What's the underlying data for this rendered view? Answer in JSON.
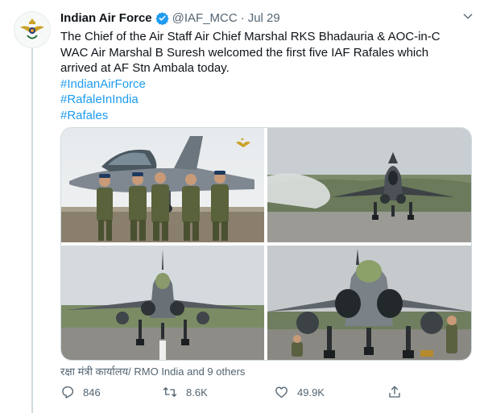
{
  "tweet": {
    "author_name": "Indian Air Force",
    "handle": "@IAF_MCC",
    "separator": "·",
    "date": "Jul 29",
    "text_lines": [
      "The Chief of the Air Staff Air Chief Marshal RKS Bhadauria & AOC-in-C",
      "WAC Air Marshal B Suresh welcomed the first five IAF Rafales which",
      "arrived at AF Stn Ambala today."
    ],
    "hashtags": [
      "#IndianAirForce",
      "#RafaleInIndia",
      "#Rafales"
    ],
    "tagged_text": "रक्षा मंत्री कार्यालय/ RMO India and 9 others"
  },
  "actions": {
    "reply_count": "846",
    "retweet_count": "8.6K",
    "like_count": "49.9K"
  },
  "media": [
    {
      "subject": "officers-with-rafale"
    },
    {
      "subject": "rafale-landing"
    },
    {
      "subject": "rafale-front-view"
    },
    {
      "subject": "rafale-front-with-crew"
    }
  ],
  "colors": {
    "accent": "#1d9bf0",
    "text_secondary": "#536471",
    "divider": "#cfd9de"
  },
  "icons": [
    "iaf-emblem-icon",
    "verified-badge-icon",
    "chevron-down-icon",
    "tag-user-icon",
    "reply-icon",
    "retweet-icon",
    "like-icon",
    "share-icon"
  ]
}
